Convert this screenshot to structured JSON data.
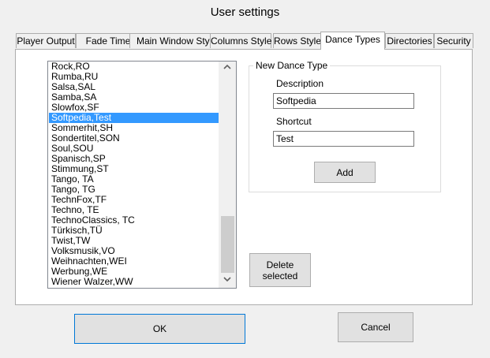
{
  "window": {
    "title": "User settings"
  },
  "tabs": [
    {
      "label": "Player Output"
    },
    {
      "label": "Fade Times"
    },
    {
      "label": "Main Window Style"
    },
    {
      "label": "Columns Style"
    },
    {
      "label": "Rows Style"
    },
    {
      "label": "Dance Types",
      "active": true
    },
    {
      "label": "Directories"
    },
    {
      "label": "Security"
    }
  ],
  "dance_list": {
    "selected_index": 5,
    "items": [
      "Rock,RO",
      "Rumba,RU",
      "Salsa,SAL",
      "Samba,SA",
      "Slowfox,SF",
      "Softpedia,Test",
      "Sommerhit,SH",
      "Sondertitel,SON",
      "Soul,SOU",
      "Spanisch,SP",
      "Stimmung,ST",
      "Tango, TA",
      "Tango, TG",
      "TechnFox,TF",
      "Techno, TE",
      "TechnoClassics, TC",
      "Türkisch,TÜ",
      "Twist,TW",
      "Volksmusik,VO",
      "Weihnachten,WEI",
      "Werbung,WE",
      "Wiener Walzer,WW"
    ]
  },
  "new_dance_type": {
    "title": "New Dance Type",
    "description_label": "Description",
    "description_value": "Softpedia",
    "shortcut_label": "Shortcut",
    "shortcut_value": "Test",
    "add_label": "Add"
  },
  "delete_button": {
    "line1": "Delete",
    "line2": "selected"
  },
  "footer": {
    "ok_label": "OK",
    "cancel_label": "Cancel"
  },
  "icons": {
    "scroll_up": "chevron-up-icon",
    "scroll_down": "chevron-down-icon"
  }
}
